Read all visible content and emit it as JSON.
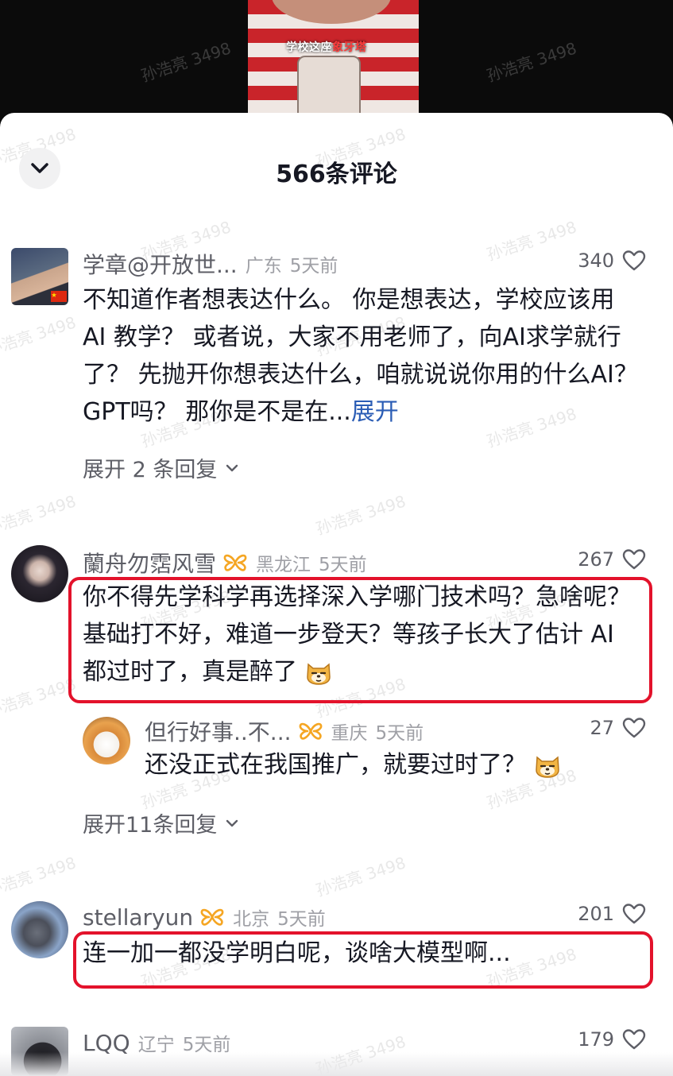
{
  "video": {
    "caption_plain": "学校这座",
    "caption_highlight": "象牙塔"
  },
  "watermark": "孙浩亮 3498",
  "sheet": {
    "title": "566条评论"
  },
  "comments": [
    {
      "username": "学章@开放世...",
      "location": "广东",
      "time": "5天前",
      "likes": "340",
      "text": "不知道作者想表达什么。 你是想表达，学校应该用 AI 教学？ 或者说，大家不用老师了，向AI求学就行了？ 先抛开你想表达什么，咱就说说你用的什么AI？ GPT吗？ 那你是不是在...",
      "more_label": "展开",
      "expand_replies": "展开 2 条回复"
    },
    {
      "username": "蘭舟勿霑风雪",
      "location": "黑龙江",
      "time": "5天前",
      "likes": "267",
      "text": "你不得先学科学再选择深入学哪门技术吗？急啥呢？基础打不好，难道一步登天？等孩子长大了估计 AI 都过时了，真是醉了",
      "reply": {
        "username": "但行好事..不...",
        "location": "重庆",
        "time": "5天前",
        "likes": "27",
        "text": "还没正式在我国推广，就要过时了？"
      },
      "expand_replies": "展开11条回复"
    },
    {
      "username": "stellaryun",
      "location": "北京",
      "time": "5天前",
      "likes": "201",
      "text": "连一加一都没学明白呢，谈啥大模型啊..."
    },
    {
      "username": "LQQ",
      "location": "辽宁",
      "time": "5天前",
      "likes": "179"
    }
  ],
  "icons": {
    "collapse": "chevron-down-icon",
    "like": "heart-outline-icon",
    "badge": "butterfly-badge-icon",
    "expand": "chevron-down-icon",
    "flag": "china-flag-icon",
    "emoji": "dog-face-emoji-icon"
  },
  "colors": {
    "highlight_box": "#e3122b",
    "link": "#2b5db5",
    "badge": "#f5a623"
  }
}
